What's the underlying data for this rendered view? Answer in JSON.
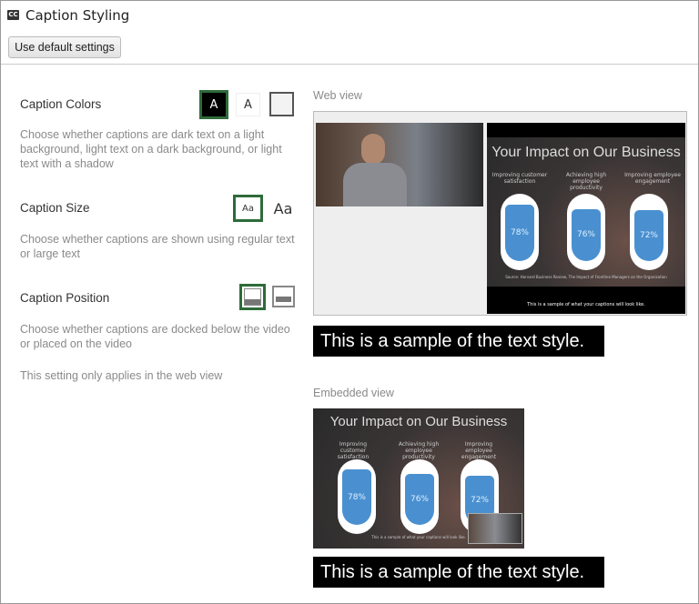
{
  "header": {
    "title": "Caption Styling",
    "icon": "closed-captions-icon",
    "default_button": "Use default settings"
  },
  "settings": {
    "colors": {
      "label": "Caption Colors",
      "desc": "Choose whether captions are dark text on a light background, light text on a dark background, or light text with a shadow",
      "options": [
        "A",
        "A",
        ""
      ],
      "selected": 0
    },
    "size": {
      "label": "Caption Size",
      "desc": "Choose whether captions are shown using regular text or large text",
      "options": [
        "Aa",
        "Aa"
      ],
      "selected": 0
    },
    "position": {
      "label": "Caption Position",
      "desc": "Choose whether captions are docked below the video or placed on the video",
      "selected": 0
    },
    "note": "This setting only applies in the web view"
  },
  "preview": {
    "web_label": "Web view",
    "embedded_label": "Embedded view",
    "sample_text": "This is a sample of the text style.",
    "slide": {
      "title": "Your Impact on Our Business",
      "stats": [
        {
          "label": "Improving customer satisfaction",
          "value": "78%"
        },
        {
          "label": "Achieving high employee productivity",
          "value": "76%"
        },
        {
          "label": "Improving employee engagement",
          "value": "72%"
        }
      ],
      "source": "Source: Harvard Business Review, The Impact of Frontline Managers on the Organization",
      "caption": "This is a sample of what your captions will look like."
    }
  },
  "colors": {
    "selected_border": "#2e6b3a",
    "bar_fill": "#4a90d0"
  }
}
